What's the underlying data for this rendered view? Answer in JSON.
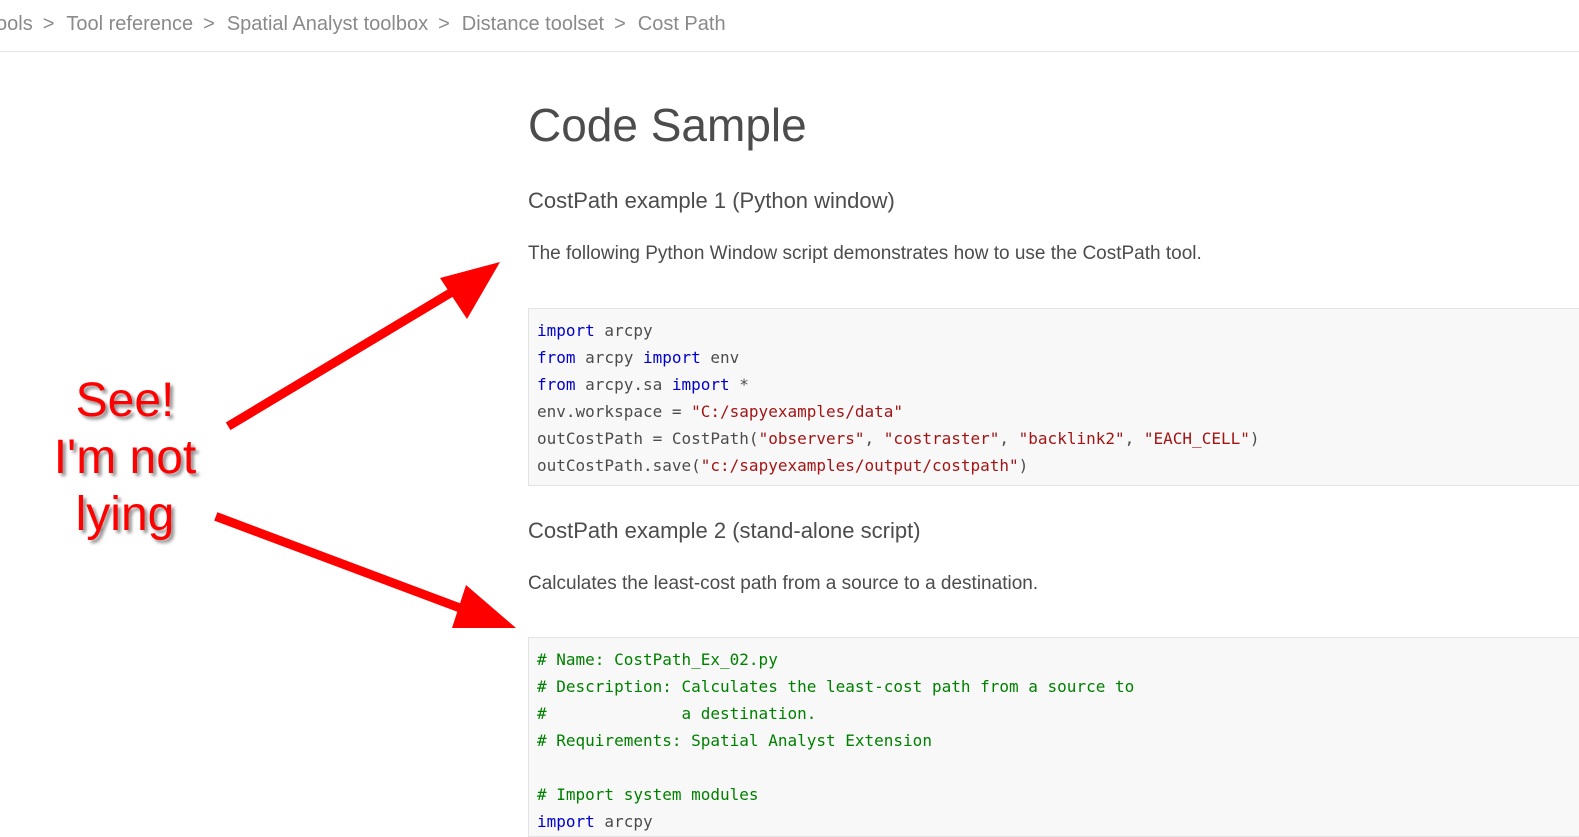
{
  "breadcrumb": [
    {
      "label": "Tools"
    },
    {
      "label": "Tool reference"
    },
    {
      "label": "Spatial Analyst toolbox"
    },
    {
      "label": "Distance toolset"
    },
    {
      "label": "Cost Path"
    }
  ],
  "breadcrumb_separator": ">",
  "page_title": "Code Sample",
  "example1": {
    "title": "CostPath example 1 (Python window)",
    "description": "The following Python Window script demonstrates how to use the CostPath tool.",
    "code_lines": [
      [
        {
          "t": "import",
          "c": "kw"
        },
        {
          "t": " arcpy",
          "c": "pl"
        }
      ],
      [
        {
          "t": "from",
          "c": "kw"
        },
        {
          "t": " arcpy ",
          "c": "pl"
        },
        {
          "t": "import",
          "c": "kw"
        },
        {
          "t": " env",
          "c": "pl"
        }
      ],
      [
        {
          "t": "from",
          "c": "kw"
        },
        {
          "t": " arcpy.sa ",
          "c": "pl"
        },
        {
          "t": "import",
          "c": "kw"
        },
        {
          "t": " *",
          "c": "pl"
        }
      ],
      [
        {
          "t": "env.workspace = ",
          "c": "pl"
        },
        {
          "t": "\"C:/sapyexamples/data\"",
          "c": "str"
        }
      ],
      [
        {
          "t": "outCostPath = CostPath(",
          "c": "pl"
        },
        {
          "t": "\"observers\"",
          "c": "str"
        },
        {
          "t": ", ",
          "c": "pl"
        },
        {
          "t": "\"costraster\"",
          "c": "str"
        },
        {
          "t": ", ",
          "c": "pl"
        },
        {
          "t": "\"backlink2\"",
          "c": "str"
        },
        {
          "t": ", ",
          "c": "pl"
        },
        {
          "t": "\"EACH_CELL\"",
          "c": "str"
        },
        {
          "t": ")",
          "c": "pl"
        }
      ],
      [
        {
          "t": "outCostPath.save(",
          "c": "pl"
        },
        {
          "t": "\"c:/sapyexamples/output/costpath\"",
          "c": "str"
        },
        {
          "t": ")",
          "c": "pl"
        }
      ]
    ]
  },
  "example2": {
    "title": "CostPath example 2 (stand-alone script)",
    "description": "Calculates the least-cost path from a source to a destination.",
    "code_lines": [
      [
        {
          "t": "# Name: CostPath_Ex_02.py",
          "c": "cm"
        }
      ],
      [
        {
          "t": "# Description: Calculates the least-cost path from a source to",
          "c": "cm"
        }
      ],
      [
        {
          "t": "#              a destination.",
          "c": "cm"
        }
      ],
      [
        {
          "t": "# Requirements: Spatial Analyst Extension",
          "c": "cm"
        }
      ],
      [
        {
          "t": "",
          "c": "pl"
        }
      ],
      [
        {
          "t": "# Import system modules",
          "c": "cm"
        }
      ],
      [
        {
          "t": "import",
          "c": "kw"
        },
        {
          "t": " arcpy",
          "c": "pl"
        }
      ]
    ]
  },
  "annotation": {
    "lines": [
      "See!",
      "I'm not",
      "lying"
    ],
    "color": "#ff0000"
  },
  "colors": {
    "keyword": "#0000cc",
    "string": "#a31515",
    "comment": "#008000",
    "arrow": "#ff0000"
  }
}
